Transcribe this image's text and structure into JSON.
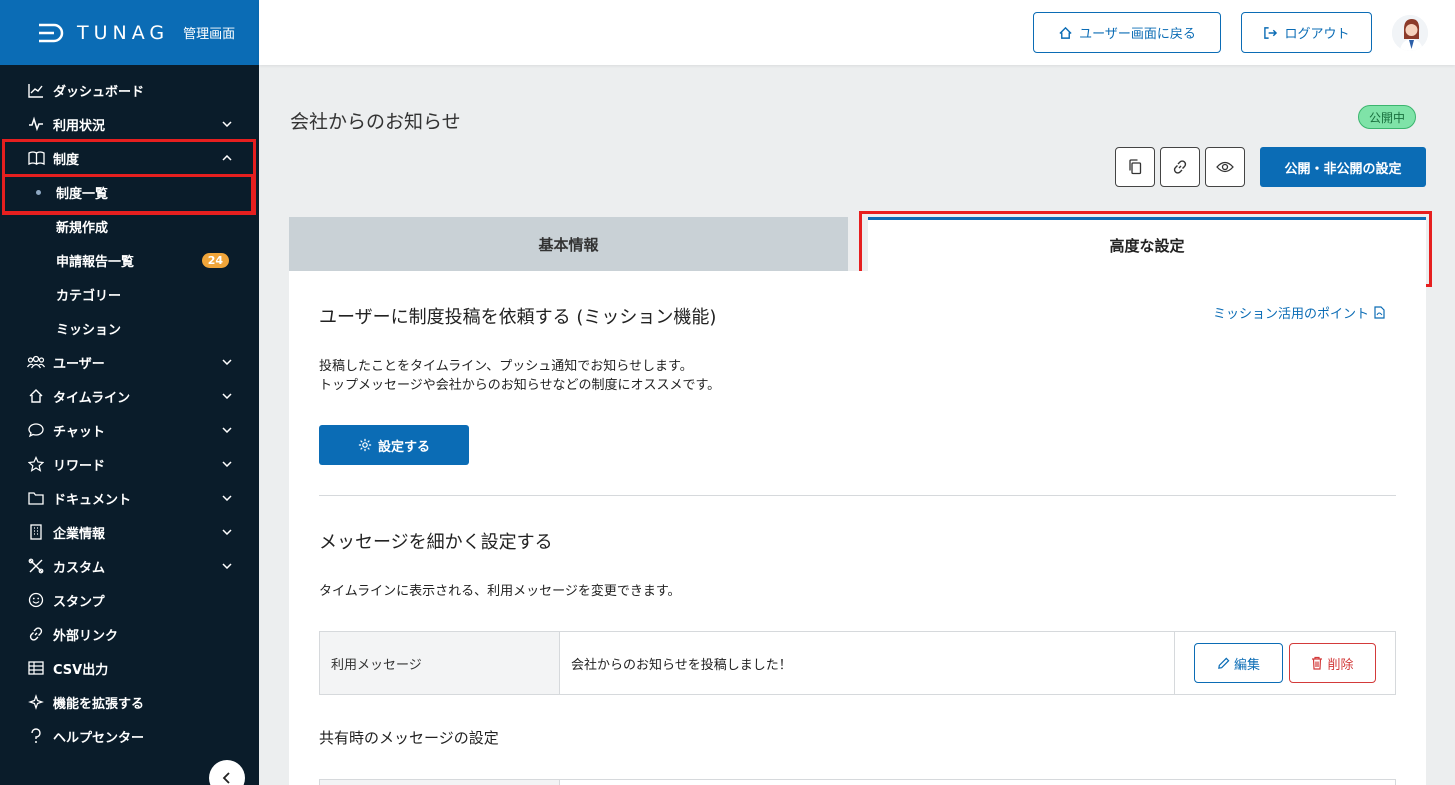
{
  "brand": {
    "logo_text": "TUNAG",
    "logo_sub": "管理画面",
    "color": "#0b6cb5"
  },
  "sidebar": {
    "items": [
      {
        "label": "ダッシュボード",
        "icon": "chart-line-icon",
        "chevron": ""
      },
      {
        "label": "利用状況",
        "icon": "pulse-icon",
        "chevron": "down"
      },
      {
        "label": "制度",
        "icon": "book-icon",
        "chevron": "up"
      }
    ],
    "sub_items": [
      {
        "label": "制度一覧",
        "active": true,
        "badge": ""
      },
      {
        "label": "新規作成",
        "badge": ""
      },
      {
        "label": "申請報告一覧",
        "badge": "24"
      },
      {
        "label": "カテゴリー",
        "badge": ""
      },
      {
        "label": "ミッション",
        "badge": ""
      }
    ],
    "items2": [
      {
        "label": "ユーザー",
        "icon": "users-icon",
        "chevron": "down"
      },
      {
        "label": "タイムライン",
        "icon": "home-icon",
        "chevron": "down"
      },
      {
        "label": "チャット",
        "icon": "chat-icon",
        "chevron": "down"
      },
      {
        "label": "リワード",
        "icon": "star-icon",
        "chevron": "down"
      },
      {
        "label": "ドキュメント",
        "icon": "folder-icon",
        "chevron": "down"
      },
      {
        "label": "企業情報",
        "icon": "building-icon",
        "chevron": "down"
      },
      {
        "label": "カスタム",
        "icon": "tools-icon",
        "chevron": "down"
      },
      {
        "label": "スタンプ",
        "icon": "smile-icon",
        "chevron": ""
      },
      {
        "label": "外部リンク",
        "icon": "link-icon",
        "chevron": ""
      },
      {
        "label": "CSV出力",
        "icon": "table-icon",
        "chevron": ""
      },
      {
        "label": "機能を拡張する",
        "icon": "sparkle-icon",
        "chevron": ""
      },
      {
        "label": "ヘルプセンター",
        "icon": "question-icon",
        "chevron": ""
      }
    ]
  },
  "header": {
    "back_label": "ユーザー画面に戻る",
    "logout_label": "ログアウト"
  },
  "page": {
    "title": "会社からのお知らせ",
    "status": "公開中",
    "publish_button": "公開・非公開の設定"
  },
  "tabs": {
    "basic": "基本情報",
    "advanced": "高度な設定"
  },
  "mission": {
    "title": "ユーザーに制度投稿を依頼する (ミッション機能)",
    "link": "ミッション活用のポイント",
    "desc1": "投稿したことをタイムライン、プッシュ通知でお知らせします。",
    "desc2": "トップメッセージや会社からのお知らせなどの制度にオススメです。",
    "button": "設定する"
  },
  "message": {
    "title": "メッセージを細かく設定する",
    "desc": "タイムラインに表示される、利用メッセージを変更できます。",
    "row_label": "利用メッセージ",
    "row_value": "会社からのお知らせを投稿しました！",
    "edit": "編集",
    "delete": "削除"
  },
  "share": {
    "title": "共有時のメッセージの設定"
  }
}
